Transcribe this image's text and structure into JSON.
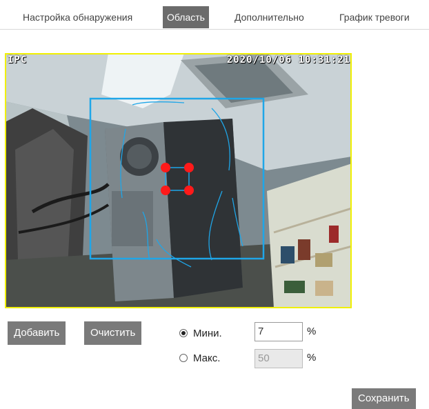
{
  "tabs": [
    {
      "label": "Настройка обнаружения",
      "active": false
    },
    {
      "label": "Область",
      "active": true
    },
    {
      "label": "Дополнительно",
      "active": false
    },
    {
      "label": "График тревоги",
      "active": false
    }
  ],
  "video": {
    "channel_label": "IPC",
    "timestamp": "2020/10/06 10:31:21",
    "frame_color": "#f0f000",
    "region_color": "#1fa6e8",
    "handle_color": "#ff1a1a"
  },
  "actions": {
    "add_label": "Добавить",
    "clear_label": "Очистить"
  },
  "size_filter": {
    "min_label": "Мини.",
    "min_value": "7",
    "min_checked": true,
    "max_label": "Макс.",
    "max_value": "50",
    "max_checked": false,
    "unit": "%"
  },
  "save_label": "Сохранить"
}
